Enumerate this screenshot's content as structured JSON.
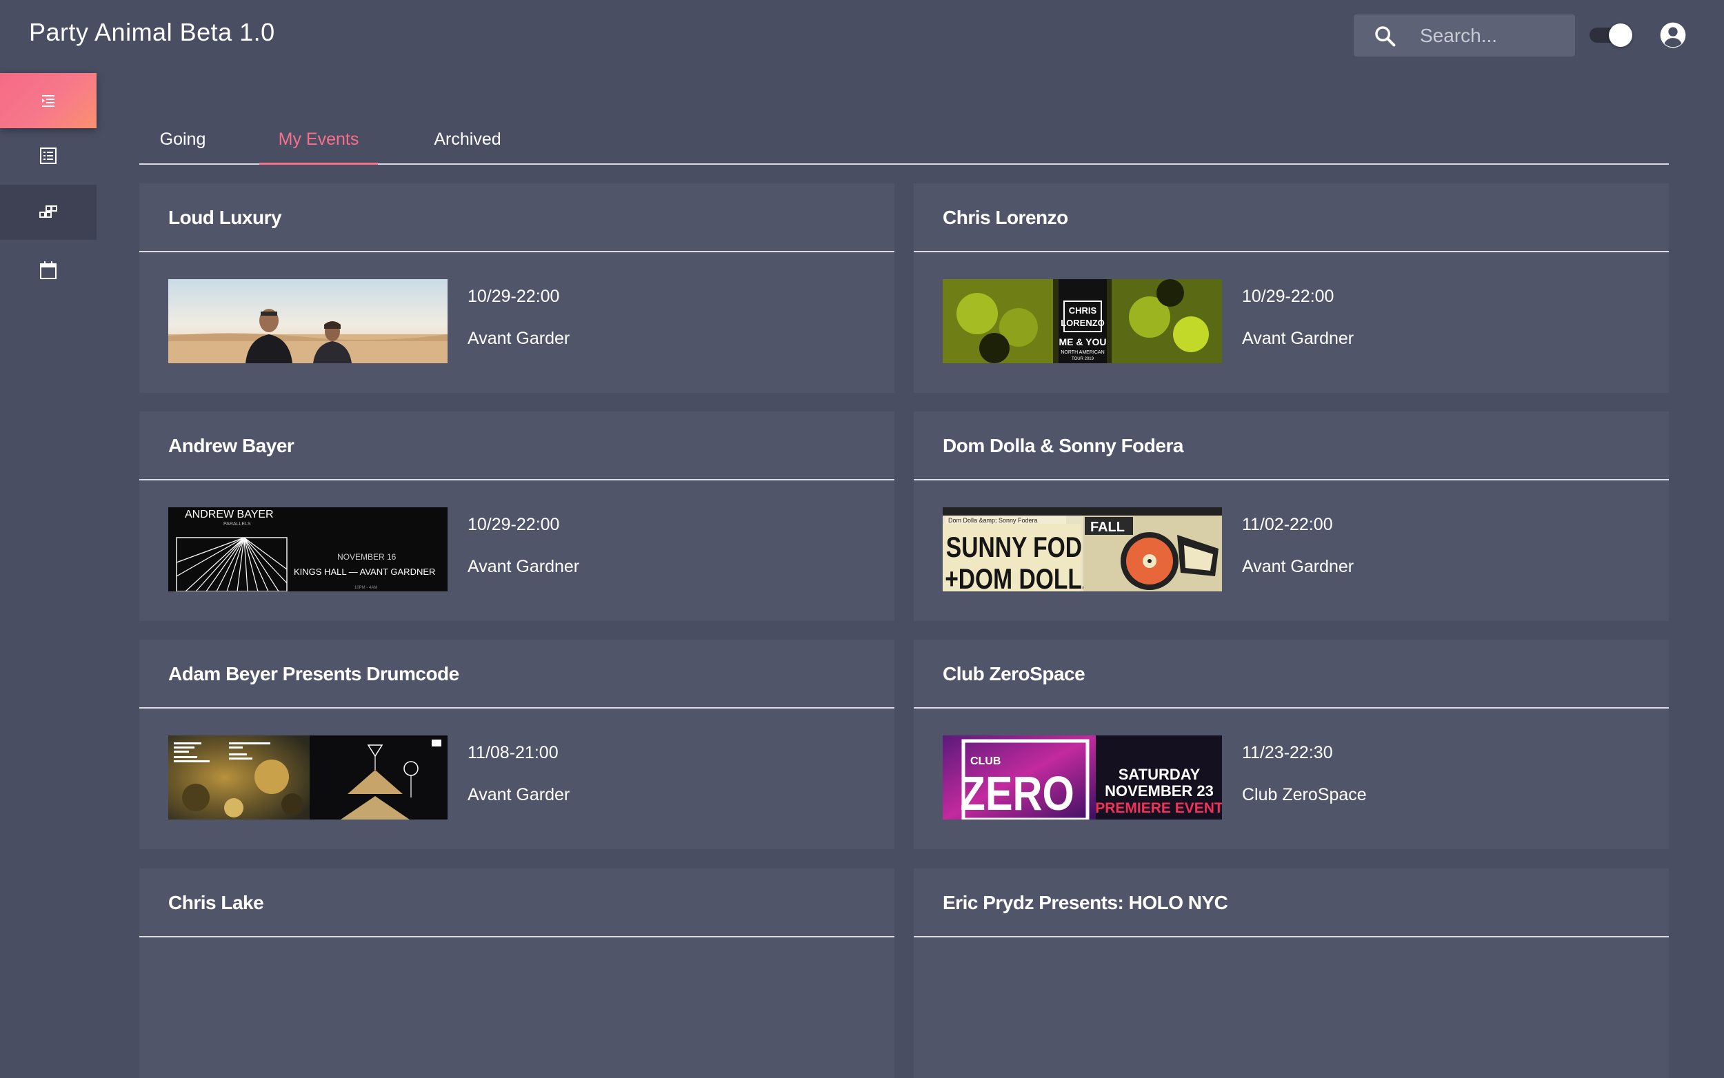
{
  "app": {
    "title": "Party Animal Beta 1.0"
  },
  "search": {
    "placeholder": "Search..."
  },
  "colors": {
    "background": "#494e63",
    "card": "#505569",
    "accent": "#f7708a"
  },
  "sidebar": {
    "items": [
      {
        "icon": "list-indent-icon",
        "active": true
      },
      {
        "icon": "list-box-icon",
        "active": false
      },
      {
        "icon": "modules-icon",
        "active": false
      },
      {
        "icon": "calendar-icon",
        "active": false
      }
    ]
  },
  "tabs": [
    {
      "label": "Going",
      "active": false
    },
    {
      "label": "My Events",
      "active": true
    },
    {
      "label": "Archived",
      "active": false
    }
  ],
  "events": [
    {
      "title": "Loud Luxury",
      "date": "10/29-22:00",
      "venue": "Avant Garder"
    },
    {
      "title": "Chris Lorenzo",
      "date": "10/29-22:00",
      "venue": "Avant Gardner",
      "poster_text": [
        "CHRIS",
        "LORENZO",
        "ME & YOU",
        "NORTH AMERICAN",
        "TOUR 2019"
      ]
    },
    {
      "title": "Andrew Bayer",
      "date": "10/29-22:00",
      "venue": "Avant Gardner",
      "poster_text": [
        "ANDREW BAYER",
        "PARALLELS",
        "NOVEMBER 16",
        "KINGS HALL — AVANT GARDNER",
        "10PM - 4AM"
      ]
    },
    {
      "title": "Dom Dolla & Sonny Fodera",
      "date": "11/02-22:00",
      "venue": "Avant Gardner",
      "poster_text": [
        "Dom Dolla &amp; Sonny Fodera",
        "SUNNY FODERA",
        "+DOM DOLLA",
        "FALL"
      ]
    },
    {
      "title": "Adam Beyer Presents Drumcode",
      "date": "11/08-21:00",
      "venue": "Avant Garder"
    },
    {
      "title": "Club ZeroSpace",
      "date": "11/23-22:30",
      "venue": "Club ZeroSpace",
      "poster_text": [
        "CLUB",
        "ZERO",
        "SATURDAY",
        "NOVEMBER 23",
        "PREMIERE EVENT"
      ]
    },
    {
      "title": "Chris Lake"
    },
    {
      "title": "Eric Prydz Presents: HOLO NYC"
    }
  ]
}
